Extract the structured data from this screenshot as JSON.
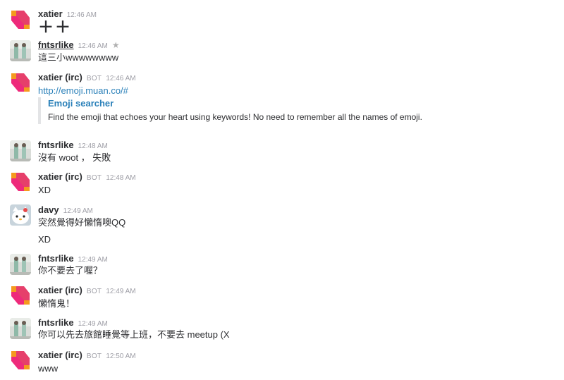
{
  "messages": [
    {
      "user": "xatier",
      "time": "12:46 AM",
      "lines": [
        "＋＋"
      ]
    },
    {
      "user": "fntsrlike",
      "time": "12:46 AM",
      "star": "★",
      "lines": [
        "這三小wwwwwwww"
      ]
    },
    {
      "user": "xatier (irc)",
      "bot": "BOT",
      "time": "12:46 AM",
      "lines": [
        "http://emoji.muan.co/#"
      ],
      "attachment": {
        "title": "Emoji searcher",
        "text": "Find the emoji that echoes your heart using keywords! No need to remember all the names of emoji."
      }
    },
    {
      "user": "fntsrlike",
      "time": "12:48 AM",
      "lines": [
        "沒有 woot ， 失敗"
      ]
    },
    {
      "user": "xatier (irc)",
      "bot": "BOT",
      "time": "12:48 AM",
      "lines": [
        "XD"
      ]
    },
    {
      "user": "davy",
      "time": "12:49 AM",
      "lines": [
        "突然覺得好懶惰噢QQ",
        "XD"
      ]
    },
    {
      "user": "fntsrlike",
      "time": "12:49 AM",
      "lines": [
        "你不要去了喔？"
      ]
    },
    {
      "user": "xatier (irc)",
      "bot": "BOT",
      "time": "12:49 AM",
      "lines": [
        "懶惰鬼！"
      ]
    },
    {
      "user": "fntsrlike",
      "time": "12:49 AM",
      "lines": [
        "你可以先去旅館睡覺等上班，不要去 meetup (X"
      ]
    },
    {
      "user": "xatier (irc)",
      "bot": "BOT",
      "time": "12:50 AM",
      "lines": [
        "www"
      ]
    }
  ],
  "colors": {
    "link": "#2a80b9",
    "timestamp": "#9e9ea6",
    "attachment_bar": "#e3e4e6"
  },
  "icons": {
    "xatier_avatar": "logo-icon",
    "fntsrlike_avatar": "photo-avatar-icon",
    "davy_avatar": "cat-avatar-icon",
    "star": "star-icon"
  }
}
